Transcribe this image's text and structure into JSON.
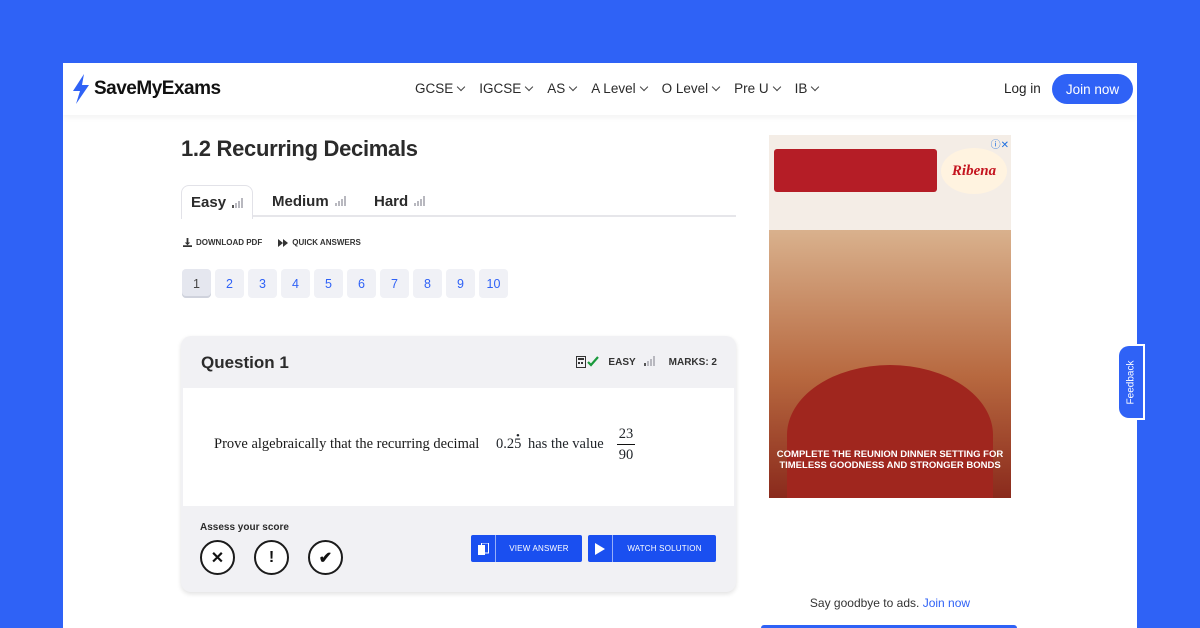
{
  "header": {
    "logo": "SaveMyExams",
    "nav": [
      "GCSE",
      "IGCSE",
      "AS",
      "A Level",
      "O Level",
      "Pre U",
      "IB"
    ],
    "login": "Log in",
    "join": "Join now"
  },
  "page": {
    "title": "1.2 Recurring Decimals",
    "tabs": [
      "Easy",
      "Medium",
      "Hard"
    ],
    "download": "DOWNLOAD PDF",
    "quick": "QUICK ANSWERS",
    "question_numbers": [
      "1",
      "2",
      "3",
      "4",
      "5",
      "6",
      "7",
      "8",
      "9",
      "10"
    ]
  },
  "question": {
    "title": "Question 1",
    "difficulty": "EASY",
    "marks": "MARKS: 2",
    "text": "Prove algebraically that the recurring decimal",
    "decimal": "0.25",
    "text2": "has the value",
    "numerator": "23",
    "denominator": "90",
    "assess_label": "Assess your score",
    "view_answer": "VIEW ANSWER",
    "watch_solution": "WATCH SOLUTION"
  },
  "ad": {
    "brand": "Ribena",
    "copy": "COMPLETE THE REUNION DINNER SETTING FOR TIMELESS GOODNESS AND STRONGER BONDS",
    "goodbye": "Say goodbye to ads.",
    "goodbye_link": "Join now"
  },
  "feedback": "Feedback",
  "colors": {
    "brand": "#2f62f6",
    "button": "#1a4ff0"
  }
}
